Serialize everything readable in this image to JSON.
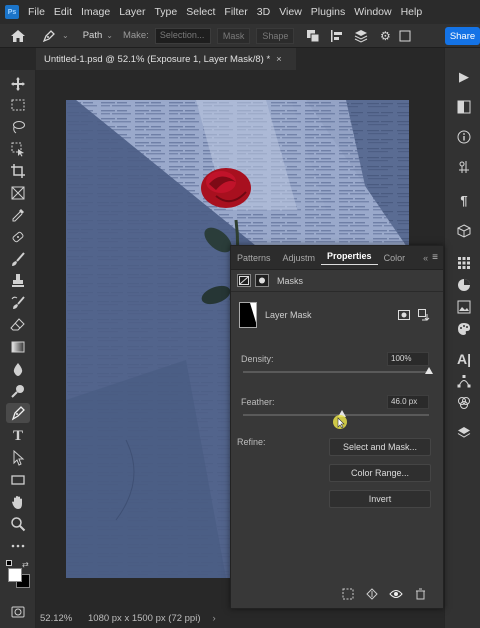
{
  "menubar": {
    "logo": "Ps",
    "items": [
      "File",
      "Edit",
      "Image",
      "Layer",
      "Type",
      "Select",
      "Filter",
      "3D",
      "View",
      "Plugins",
      "Window",
      "Help"
    ]
  },
  "options": {
    "mode": "Path",
    "make_label": "Make:",
    "selection": "Selection...",
    "mask": "Mask",
    "shape": "Shape",
    "share": "Share"
  },
  "document": {
    "tab_title": "Untitled-1.psd @ 52.1% (Exposure 1, Layer Mask/8) *",
    "close": "×"
  },
  "status": {
    "zoom": "52.12%",
    "dimensions": "1080 px x 1500 px (72 ppi)"
  },
  "properties": {
    "tabs": [
      "Patterns",
      "Adjustm",
      "Properties",
      "Color"
    ],
    "active_tab": "Properties",
    "collapse": "«",
    "menu": "≡",
    "masks_label": "Masks",
    "layer_mask_label": "Layer Mask",
    "density_label": "Density:",
    "density_value": "100%",
    "density_level": 100,
    "feather_label": "Feather:",
    "feather_value": "46.0 px",
    "feather_level_pct": 53,
    "refine_label": "Refine:",
    "select_and_mask": "Select and Mask...",
    "color_range": "Color Range...",
    "invert": "Invert"
  },
  "colors": {
    "accent": "#1473e6",
    "image_tint": "#56698e",
    "rose": "#c0132a"
  }
}
